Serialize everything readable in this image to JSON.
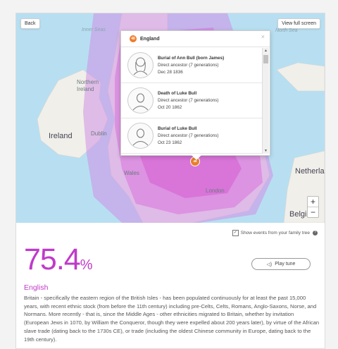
{
  "map": {
    "back_label": "Back",
    "fullscreen_label": "View full screen",
    "labels": {
      "inner_seas": "Inner Seas",
      "north_sea": "North Sea",
      "northern_ireland": "Northern Ireland",
      "ireland": "Ireland",
      "dublin": "Dublin",
      "wales": "Wales",
      "london": "London",
      "netherlands": "Netherla",
      "belgium": "Belgi"
    },
    "zoom_in": "+",
    "zoom_out": "−",
    "pin_badge": "48"
  },
  "popup": {
    "badge": "48",
    "region": "England",
    "close": "×",
    "events": [
      {
        "title": "Burial of Ann Bull (born James)",
        "relation": "Direct ancestor (7 generations)",
        "date": "Dec 28 1836",
        "avatar": "female-avatar-icon"
      },
      {
        "title": "Death of Luke Bull",
        "relation": "Direct ancestor (7 generations)",
        "date": "Oct 20 1862",
        "avatar": "male-avatar-icon"
      },
      {
        "title": "Burial of Luke Bull",
        "relation": "Direct ancestor (7 generations)",
        "date": "Oct 23 1862",
        "avatar": "male-avatar-icon"
      }
    ]
  },
  "show_events": {
    "label": "Show events from your family tree",
    "checked": true
  },
  "result": {
    "percent_value": "75.4",
    "percent_symbol": "%",
    "play_label": "Play tune",
    "ethnicity": "English",
    "description": "Britain - specifically the eastern region of the British Isles - has been populated continuously for at least the past 15,000 years, with recent ethnic stock (from before the 11th century) including pre-Celts, Celts, Romans, Anglo-Saxons, Norse, and Normans. More recently - that is, since the Middle Ages - other ethnicities migrated to Britain, whether by invitation (European Jews in 1070, by William the Conqueror, though they were expelled about 200 years later), by virtue of the African slave trade (dating back to the 1730s CE), or trade (including the oldest Chinese community in Europe, dating back to the 19th century)."
  },
  "colors": {
    "accent": "#c03ac9",
    "water": "#b7dff1",
    "land": "#f1efe9",
    "heat_outer": "#cf8fe6",
    "heat_inner": "#d44fd0",
    "pin": "#e87f2c"
  }
}
